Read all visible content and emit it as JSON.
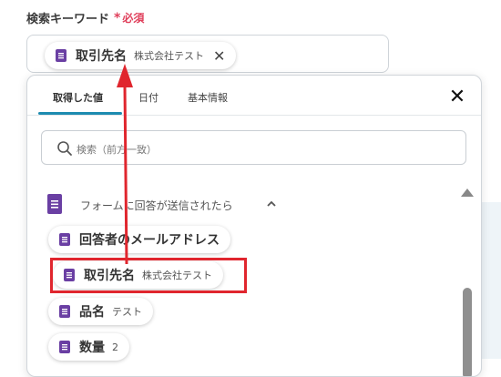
{
  "field": {
    "label": "検索キーワード",
    "required_mark": "*",
    "required_text": "必須",
    "selected_chip": {
      "label": "取引先名",
      "value": "株式会社テスト"
    }
  },
  "dropdown": {
    "tabs": [
      {
        "label": "取得した値",
        "active": true
      },
      {
        "label": "日付",
        "active": false
      },
      {
        "label": "基本情報",
        "active": false
      }
    ],
    "search": {
      "placeholder": "検索（前方一致）"
    },
    "section": {
      "title": "フォームに回答が送信されたら"
    },
    "items": [
      {
        "label": "回答者のメールアドレス",
        "value": ""
      },
      {
        "label": "取引先名",
        "value": "株式会社テスト"
      },
      {
        "label": "品名",
        "value": "テスト"
      },
      {
        "label": "数量",
        "value": "2"
      }
    ]
  },
  "colors": {
    "accent": "#1d8bb0",
    "required": "#e0405c",
    "doc_icon": "#6a3fa3",
    "annotation_red": "#e0262e"
  },
  "icons": [
    "forms-doc-icon",
    "close-icon",
    "search-icon",
    "chevron-up-icon",
    "scroll-up-icon"
  ]
}
